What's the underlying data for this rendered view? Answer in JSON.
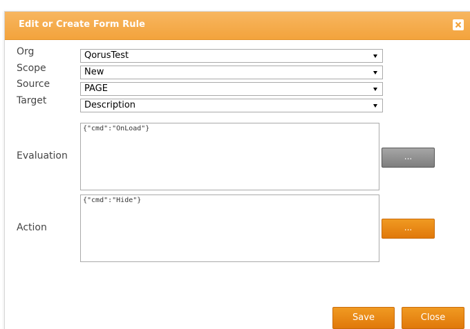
{
  "dialog": {
    "title": "Edit or Create Form Rule",
    "close_icon": "close-x-icon"
  },
  "fields": {
    "org": {
      "label": "Org",
      "value": "QorusTest"
    },
    "scope": {
      "label": "Scope",
      "value": "New"
    },
    "source": {
      "label": "Source",
      "value": "PAGE"
    },
    "target": {
      "label": "Target",
      "value": "Description"
    },
    "evaluation": {
      "label": "Evaluation",
      "value": "{\"cmd\":\"OnLoad\"}",
      "button_label": "..."
    },
    "action": {
      "label": "Action",
      "value": "{\"cmd\":\"Hide\"}",
      "button_label": "..."
    }
  },
  "footer": {
    "save_label": "Save",
    "close_label": "Close"
  },
  "colors": {
    "titlebar": "#f3a33c",
    "accent_button": "#e0780a",
    "grey_button": "#7e7e7e"
  }
}
